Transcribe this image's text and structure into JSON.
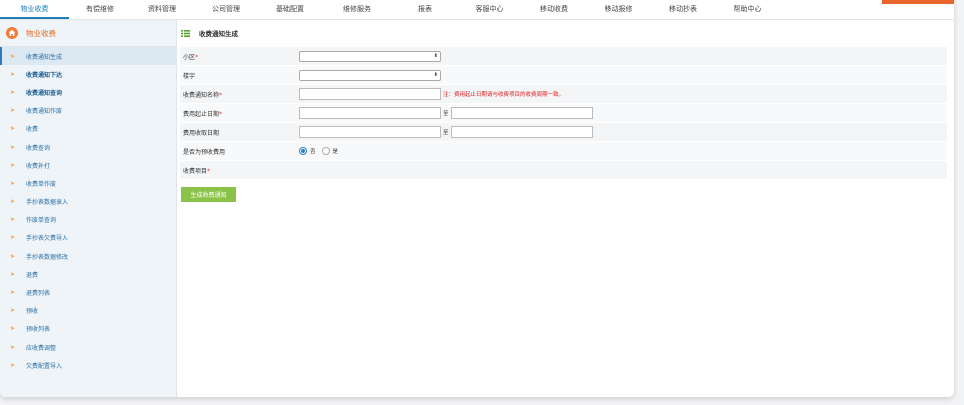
{
  "topnav": {
    "tabs": [
      {
        "label": "物业收费",
        "active": true
      },
      {
        "label": "有偿维修",
        "active": false
      },
      {
        "label": "资料管理",
        "active": false
      },
      {
        "label": "公司管理",
        "active": false
      },
      {
        "label": "基础配置",
        "active": false
      },
      {
        "label": "维修服务",
        "active": false
      },
      {
        "label": "报表",
        "active": false
      },
      {
        "label": "客服中心",
        "active": false
      },
      {
        "label": "移动收费",
        "active": false
      },
      {
        "label": "移动报修",
        "active": false
      },
      {
        "label": "移动抄表",
        "active": false
      },
      {
        "label": "帮助中心",
        "active": false
      }
    ],
    "accent_color": "#e8642a"
  },
  "sidebar": {
    "title": "物业收费",
    "icon": "home-icon",
    "items": [
      {
        "label": "收费通知生成"
      },
      {
        "label": "收费通知下达"
      },
      {
        "label": "收费通知查询"
      },
      {
        "label": "收费通知作废"
      },
      {
        "label": "收费"
      },
      {
        "label": "收费查询"
      },
      {
        "label": "收费补打"
      },
      {
        "label": "收费单作废"
      },
      {
        "label": "手抄表数据录入"
      },
      {
        "label": "作废单查询"
      },
      {
        "label": "手抄表欠费导入"
      },
      {
        "label": "手抄表数据修改"
      },
      {
        "label": "退费"
      },
      {
        "label": "退费列表"
      },
      {
        "label": "预收"
      },
      {
        "label": "预收列表"
      },
      {
        "label": "应收费调整"
      },
      {
        "label": "欠费配置导入"
      }
    ]
  },
  "main": {
    "title": "收费通知生成",
    "form": {
      "community_label": "小区",
      "building_label": "楼宇",
      "notice_name_label": "收费通知名称",
      "notice_name_note": "注：费用起止日期请与收费项目的收费周期一致。",
      "fee_period_label": "费用起止日期",
      "collect_date_label": "费用收取日期",
      "to_label": "至",
      "prepaid_label": "是否为预收费用",
      "prepaid_no": "否",
      "prepaid_yes": "是",
      "fee_items_label": "收费项目",
      "required_mark": "*",
      "select_caret": "⬍"
    },
    "generate_button": "生成收费通知"
  }
}
